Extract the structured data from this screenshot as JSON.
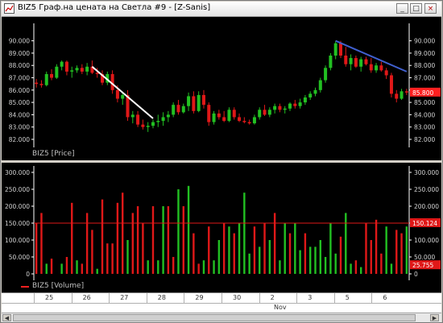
{
  "window": {
    "title": "BIZ5 Граф.на цената на Светла #9 - [Z-Sanis]",
    "minimize": "_",
    "maximize": "□",
    "close": "×"
  },
  "price_panel": {
    "label": "BIZ5 [Price]",
    "ticks": [
      "90.000",
      "89.000",
      "88.000",
      "87.000",
      "86.000",
      "85.000",
      "84.000",
      "83.000",
      "82.000"
    ],
    "right_ticks": [
      "90.000",
      "89.000",
      "88.000",
      "87.000",
      "86.000",
      "85.000",
      "84.000",
      "83.000",
      "82.000"
    ],
    "last_price": "85.800",
    "colors": {
      "up": "#22c022",
      "down": "#e01818",
      "trend_white": "#ffffff",
      "trend_blue": "#4060d0",
      "marker": "#ff2020"
    }
  },
  "volume_panel": {
    "label": "BIZ5 [Volume]",
    "ticks": [
      "300.000",
      "250.000",
      "200.000",
      "150.000",
      "100.000",
      "50.000",
      "0"
    ],
    "right_ticks": [
      "300.000",
      "250.000",
      "200.000",
      "150.000",
      "100.000",
      "50.000",
      "0"
    ],
    "level_marker": "150.124",
    "last_marker": "25.755",
    "colors": {
      "up": "#22c022",
      "down": "#e01818",
      "level": "#e01818"
    }
  },
  "xaxis": {
    "days": [
      "25",
      "26",
      "27",
      "28",
      "29",
      "30",
      "2",
      "3",
      "5",
      "6"
    ],
    "month": "Nov"
  },
  "chart_data": [
    {
      "type": "candlestick",
      "title": "BIZ5 [Price]",
      "ylim": [
        82,
        90.5
      ],
      "candles": [
        [
          86.6,
          86.9,
          86.2,
          86.5
        ],
        [
          86.5,
          86.8,
          86.2,
          86.4
        ],
        [
          86.4,
          87.5,
          86.3,
          87.3
        ],
        [
          87.3,
          87.7,
          86.8,
          87.0
        ],
        [
          87.0,
          88.1,
          86.9,
          87.9
        ],
        [
          87.9,
          88.4,
          87.6,
          88.3
        ],
        [
          88.3,
          88.4,
          87.2,
          87.5
        ],
        [
          87.5,
          87.9,
          87.0,
          87.6
        ],
        [
          87.6,
          88.0,
          87.4,
          87.8
        ],
        [
          87.8,
          88.1,
          87.3,
          87.5
        ],
        [
          87.5,
          88.2,
          87.2,
          87.9
        ],
        [
          87.9,
          88.4,
          87.3,
          87.4
        ],
        [
          87.4,
          87.8,
          87.0,
          87.3
        ],
        [
          87.3,
          87.6,
          86.4,
          86.6
        ],
        [
          86.6,
          87.5,
          86.4,
          87.3
        ],
        [
          87.3,
          87.6,
          85.7,
          86.0
        ],
        [
          86.0,
          86.4,
          85.0,
          85.3
        ],
        [
          85.3,
          85.8,
          84.8,
          85.6
        ],
        [
          85.6,
          86.0,
          83.5,
          83.8
        ],
        [
          83.8,
          84.3,
          83.3,
          84.0
        ],
        [
          84.0,
          84.3,
          83.0,
          83.2
        ],
        [
          83.2,
          83.6,
          82.8,
          83.0
        ],
        [
          83.0,
          83.4,
          82.6,
          83.1
        ],
        [
          83.1,
          83.6,
          82.9,
          83.4
        ],
        [
          83.4,
          84.0,
          83.0,
          83.5
        ],
        [
          83.5,
          84.2,
          83.1,
          83.8
        ],
        [
          83.8,
          84.3,
          83.4,
          84.0
        ],
        [
          84.0,
          85.0,
          83.8,
          84.8
        ],
        [
          84.8,
          85.2,
          84.0,
          84.2
        ],
        [
          84.2,
          84.9,
          84.1,
          84.7
        ],
        [
          84.7,
          85.8,
          84.3,
          85.5
        ],
        [
          85.5,
          85.9,
          84.1,
          84.3
        ],
        [
          84.3,
          85.9,
          84.2,
          85.6
        ],
        [
          85.6,
          86.0,
          84.5,
          84.8
        ],
        [
          84.8,
          85.0,
          83.1,
          83.4
        ],
        [
          83.4,
          84.3,
          83.2,
          84.1
        ],
        [
          84.1,
          84.4,
          83.6,
          83.8
        ],
        [
          83.8,
          84.3,
          83.4,
          83.5
        ],
        [
          83.5,
          84.6,
          83.4,
          84.4
        ],
        [
          84.4,
          84.6,
          83.6,
          83.8
        ],
        [
          83.8,
          84.1,
          83.4,
          83.5
        ],
        [
          83.5,
          83.8,
          83.3,
          83.4
        ],
        [
          83.4,
          83.6,
          83.2,
          83.3
        ],
        [
          83.3,
          84.0,
          83.2,
          83.8
        ],
        [
          83.8,
          84.6,
          83.6,
          84.4
        ],
        [
          84.4,
          84.8,
          83.9,
          84.0
        ],
        [
          84.0,
          84.6,
          83.8,
          84.4
        ],
        [
          84.4,
          84.9,
          84.1,
          84.7
        ],
        [
          84.7,
          84.9,
          84.2,
          84.4
        ],
        [
          84.4,
          84.7,
          84.1,
          84.5
        ],
        [
          84.5,
          85.0,
          84.3,
          84.9
        ],
        [
          84.9,
          85.2,
          84.5,
          84.7
        ],
        [
          84.7,
          85.3,
          84.5,
          85.0
        ],
        [
          85.0,
          85.6,
          84.8,
          85.4
        ],
        [
          85.4,
          85.9,
          85.2,
          85.7
        ],
        [
          85.7,
          86.2,
          85.5,
          86.0
        ],
        [
          86.0,
          87.0,
          85.8,
          86.8
        ],
        [
          86.8,
          88.0,
          86.6,
          87.8
        ],
        [
          87.8,
          89.0,
          87.6,
          88.8
        ],
        [
          88.8,
          90.0,
          88.5,
          89.8
        ],
        [
          89.8,
          90.0,
          88.6,
          88.8
        ],
        [
          88.8,
          89.5,
          87.9,
          88.1
        ],
        [
          88.1,
          88.9,
          87.6,
          88.6
        ],
        [
          88.6,
          88.8,
          87.8,
          87.9
        ],
        [
          87.9,
          88.7,
          87.5,
          88.5
        ],
        [
          88.5,
          88.7,
          88.0,
          88.1
        ],
        [
          88.1,
          88.6,
          87.4,
          87.6
        ],
        [
          87.6,
          88.2,
          87.4,
          88.0
        ],
        [
          88.0,
          88.3,
          87.5,
          87.6
        ],
        [
          87.6,
          87.8,
          86.9,
          87.2
        ],
        [
          87.2,
          87.4,
          85.4,
          85.7
        ],
        [
          85.7,
          86.0,
          85.0,
          85.3
        ],
        [
          85.3,
          86.1,
          85.2,
          85.9
        ],
        [
          85.9,
          86.1,
          85.6,
          85.8
        ]
      ],
      "trendlines": [
        {
          "name": "white",
          "from": [
            11,
            87.9
          ],
          "to": [
            23,
            83.7
          ]
        },
        {
          "name": "blue",
          "from": [
            59,
            90.0
          ],
          "to": [
            73,
            87.5
          ]
        }
      ],
      "day_labels": [
        "25",
        "26",
        "27",
        "28",
        "29",
        "30",
        "2",
        "3",
        "5",
        "6"
      ],
      "month": "Nov"
    },
    {
      "type": "bar",
      "title": "BIZ5 [Volume]",
      "ylim": [
        0,
        300000
      ],
      "values": [
        150,
        180,
        30,
        45,
        0,
        30,
        50,
        210,
        40,
        30,
        180,
        130,
        15,
        220,
        90,
        90,
        210,
        240,
        100,
        180,
        200,
        150,
        40,
        200,
        40,
        200,
        200,
        50,
        250,
        200,
        260,
        120,
        30,
        40,
        140,
        40,
        100,
        150,
        140,
        120,
        150,
        240,
        60,
        140,
        80,
        150,
        100,
        180,
        40,
        150,
        120,
        150,
        70,
        120,
        80,
        80,
        100,
        50,
        150,
        60,
        110,
        180,
        30,
        40,
        20,
        150,
        100,
        160,
        60,
        140,
        30,
        130,
        120,
        140
      ],
      "directions": [
        "d",
        "d",
        "u",
        "d",
        "d",
        "u",
        "d",
        "d",
        "u",
        "d",
        "d",
        "d",
        "u",
        "d",
        "d",
        "d",
        "d",
        "d",
        "u",
        "d",
        "d",
        "d",
        "u",
        "d",
        "u",
        "u",
        "d",
        "d",
        "u",
        "d",
        "u",
        "d",
        "d",
        "u",
        "d",
        "u",
        "u",
        "d",
        "u",
        "d",
        "u",
        "u",
        "u",
        "d",
        "u",
        "d",
        "u",
        "d",
        "u",
        "u",
        "d",
        "u",
        "u",
        "d",
        "u",
        "u",
        "u",
        "u",
        "u",
        "u",
        "d",
        "u",
        "u",
        "d",
        "u",
        "d",
        "d",
        "d",
        "d",
        "u",
        "u",
        "d",
        "d",
        "u"
      ],
      "level_line": 150124,
      "last_value": 25755
    }
  ]
}
